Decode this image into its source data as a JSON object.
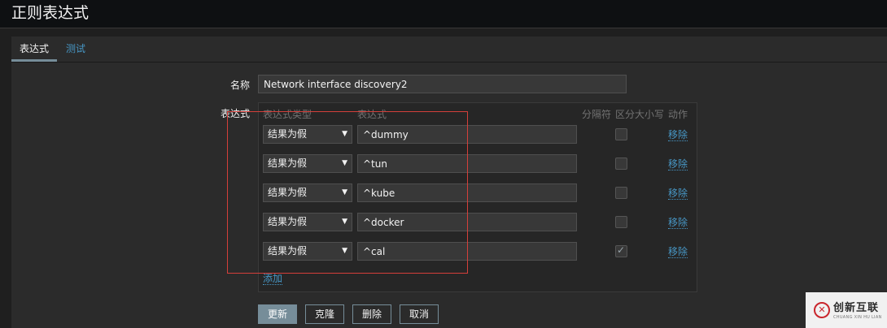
{
  "header": {
    "title": "正则表达式"
  },
  "tabs": [
    {
      "label": "表达式",
      "active": true
    },
    {
      "label": "测试",
      "active": false
    }
  ],
  "form": {
    "name_label": "名称",
    "name_value": "Network interface discovery2",
    "expressions_label": "表达式",
    "columns": {
      "type": "表达式类型",
      "expression": "表达式",
      "delimiter": "分隔符",
      "case_sensitive": "区分大小写",
      "action": "动作"
    },
    "rows": [
      {
        "type": "结果为假",
        "expression": "^dummy",
        "case_sensitive": false,
        "action": "移除"
      },
      {
        "type": "结果为假",
        "expression": "^tun",
        "case_sensitive": false,
        "action": "移除"
      },
      {
        "type": "结果为假",
        "expression": "^kube",
        "case_sensitive": false,
        "action": "移除"
      },
      {
        "type": "结果为假",
        "expression": "^docker",
        "case_sensitive": false,
        "action": "移除"
      },
      {
        "type": "结果为假",
        "expression": "^cal",
        "case_sensitive": true,
        "action": "移除"
      }
    ],
    "add_label": "添加"
  },
  "buttons": {
    "update": "更新",
    "clone": "克隆",
    "delete": "删除",
    "cancel": "取消"
  },
  "watermark": {
    "brand": "创新互联",
    "sub": "CHUANG XIN HU LIAN"
  },
  "colors": {
    "link": "#4796c4",
    "primary": "#768d99",
    "highlight_frame": "#d43f3a"
  }
}
